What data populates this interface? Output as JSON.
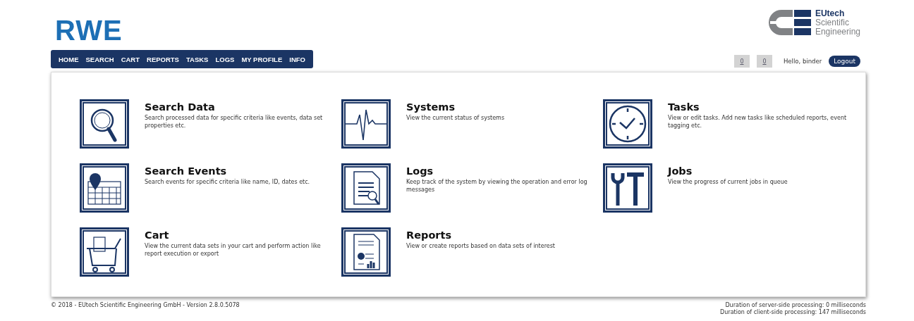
{
  "brand": {
    "logo": "RWE",
    "partner_lines": [
      "EUtech",
      "Scientific",
      "Engineering"
    ]
  },
  "nav": [
    {
      "label": "HOME"
    },
    {
      "label": "SEARCH"
    },
    {
      "label": "CART"
    },
    {
      "label": "REPORTS"
    },
    {
      "label": "TASKS"
    },
    {
      "label": "LOGS"
    },
    {
      "label": "MY PROFILE"
    },
    {
      "label": "INFO"
    }
  ],
  "user_bar": {
    "counters": [
      "0",
      "0"
    ],
    "greeting": "Hello, binder",
    "logout": "Logout"
  },
  "tiles": [
    {
      "kind": "magnifier",
      "title": "Search Data",
      "description": "Search processed data for specific criteria like events, data set properties etc."
    },
    {
      "kind": "pulse",
      "title": "Systems",
      "description": "View the current status of systems"
    },
    {
      "kind": "clock",
      "title": "Tasks",
      "description": "View or edit tasks. Add new tasks like scheduled reports, event tagging etc."
    },
    {
      "kind": "calendar",
      "title": "Search Events",
      "description": "Search events for specific criteria like name, ID, dates etc."
    },
    {
      "kind": "document",
      "title": "Logs",
      "description": "Keep track of the system by viewing the operation and error log messages"
    },
    {
      "kind": "tools",
      "title": "Jobs",
      "description": "View the progress of current jobs in queue"
    },
    {
      "kind": "cart",
      "title": "Cart",
      "description": "View the current data sets in your cart and perform action like report execution or export"
    },
    {
      "kind": "report",
      "title": "Reports",
      "description": "View or create reports based on data sets of interest"
    }
  ],
  "footer": {
    "copyright": "© 2018 - EUtech Scientific Engineering GmbH - Version 2.8.0.5078",
    "timings": [
      "Duration of server-side processing: 0 milliseconds",
      "Duration of client-side processing: 147 milliseconds"
    ]
  }
}
